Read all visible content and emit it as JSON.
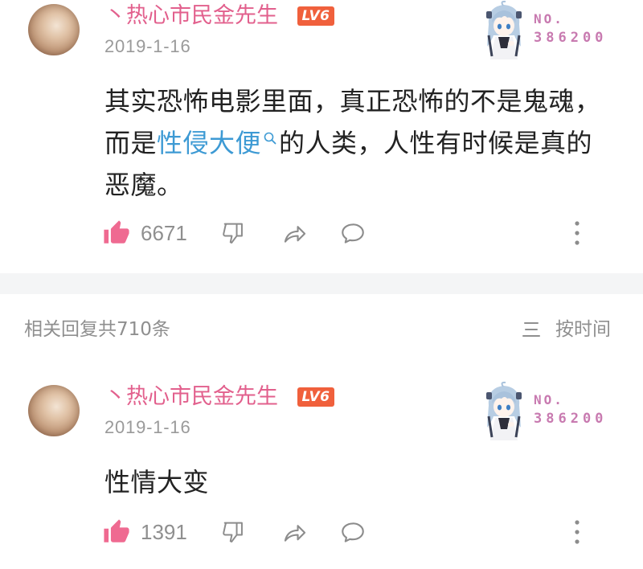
{
  "comments": [
    {
      "username": "丶热心市民金先生",
      "level": "LV6",
      "date": "2019-1-16",
      "fan_badge": {
        "label": "NO.",
        "number": "386200"
      },
      "content": {
        "line1": "其实恐怖电影里面，真正恐怖的不是鬼魂，",
        "line2_before": "而是",
        "line2_link": "性侵大便",
        "line2_after": "的人类，人性有时候是真的",
        "line3": "恶魔。"
      },
      "likes": "6671"
    },
    {
      "username": "丶热心市民金先生",
      "level": "LV6",
      "date": "2019-1-16",
      "fan_badge": {
        "label": "NO.",
        "number": "386200"
      },
      "content": {
        "line1": "性情大变"
      },
      "likes": "1391"
    }
  ],
  "replies_header": {
    "count_label": "相关回复共710条",
    "sort_label": "按时间"
  },
  "icons": {
    "like": "thumbs-up-icon",
    "dislike": "thumbs-down-icon",
    "share": "share-icon",
    "reply": "comment-icon",
    "more": "more-vertical-icon",
    "search": "search-icon",
    "sort": "sort-icon"
  },
  "colors": {
    "username": "#e2608d",
    "link": "#3d9ad4",
    "like": "#ef6a91",
    "level_badge": "#f0603c",
    "fan_badge_text": "#c87ab0",
    "date_text": "#9a9a9a",
    "meta_text": "#8f8f8f",
    "body_text": "#222222",
    "divider": "#f4f5f6",
    "icon_stroke": "#8c8c8c"
  }
}
